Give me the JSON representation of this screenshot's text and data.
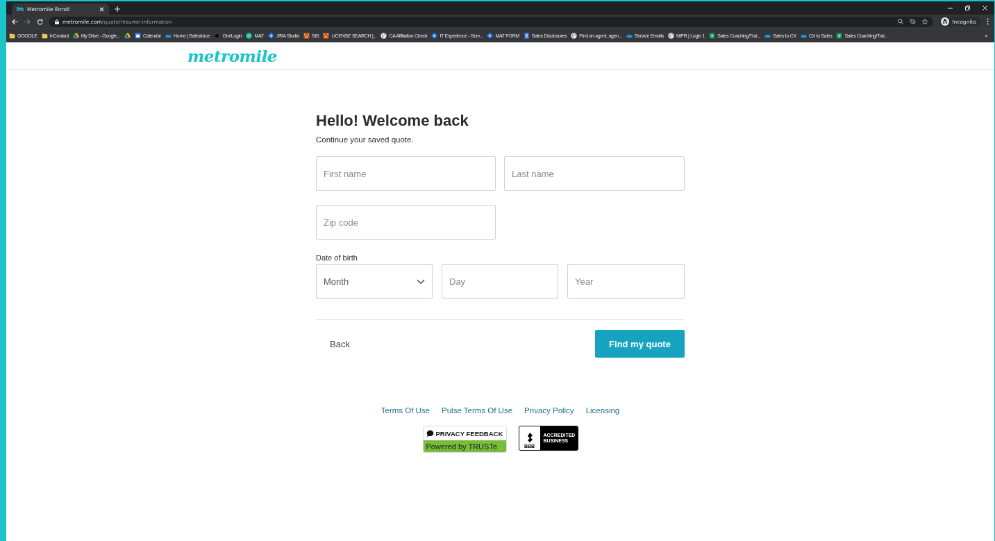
{
  "browser": {
    "tab": {
      "title": "Metromile Enroll",
      "selected": true
    },
    "address": {
      "host": "metromile.com",
      "path": "/quote/resume-information"
    },
    "profile": "Incognito",
    "bookmarks": [
      {
        "label": "GOOGLE",
        "kind": "folder"
      },
      {
        "label": "InContact",
        "kind": "folder"
      },
      {
        "label": "My Drive - Google...",
        "kind": "drive"
      },
      {
        "kind": "drive"
      },
      {
        "label": "Calendar",
        "kind": "calendar"
      },
      {
        "label": "Home | Salesforce",
        "kind": "cloud"
      },
      {
        "label": "OneLogin",
        "kind": "dot"
      },
      {
        "label": "MAT",
        "kind": "logo"
      },
      {
        "label": "JIRA Studio",
        "kind": "diamond"
      },
      {
        "label": "SIS",
        "kind": "license"
      },
      {
        "label": "LICENSE SEARCH |...",
        "kind": "license"
      },
      {
        "label": "CA Affiliation Check",
        "kind": "globe"
      },
      {
        "label": "IT Experience - Serv...",
        "kind": "diamond"
      },
      {
        "label": "MAT FORM",
        "kind": "diamond"
      },
      {
        "label": "Sales Disclosures",
        "kind": "doc"
      },
      {
        "label": "Find an agent, agen...",
        "kind": "globe"
      },
      {
        "label": "Service Emails",
        "kind": "cloud"
      },
      {
        "label": "NIPR | Login 1",
        "kind": "globe"
      },
      {
        "label": "Sales Coaching/Trai...",
        "kind": "sheet"
      },
      {
        "label": "Sales to CX",
        "kind": "cloud"
      },
      {
        "label": "CX to Sales",
        "kind": "cloud"
      },
      {
        "label": "Sales Coaching/Trai...",
        "kind": "sheet"
      }
    ],
    "more": "»"
  },
  "site": {
    "logo": "metromile"
  },
  "form": {
    "title": "Hello! Welcome back",
    "subtitle": "Continue your saved quote.",
    "fields": [
      {
        "placeholder": "First name"
      },
      {
        "placeholder": "Last name"
      },
      {
        "placeholder": "Zip code"
      }
    ],
    "dob_label": "Date of birth",
    "month": {
      "value": "Month"
    },
    "dob_fields": [
      {
        "placeholder": "Day"
      },
      {
        "placeholder": "Year"
      }
    ],
    "back": "Back",
    "submit": "Find my quote"
  },
  "footer": {
    "links": [
      "Terms Of Use",
      "Pulse Terms Of Use",
      "Privacy Policy",
      "Licensing"
    ],
    "privacy_badge": {
      "top": "PRIVACY FEEDBACK",
      "bottom": "Powered by TRUSTe"
    },
    "bbb_badge": {
      "mark": "BBB",
      "text": "ACCREDITED BUSINESS"
    }
  }
}
